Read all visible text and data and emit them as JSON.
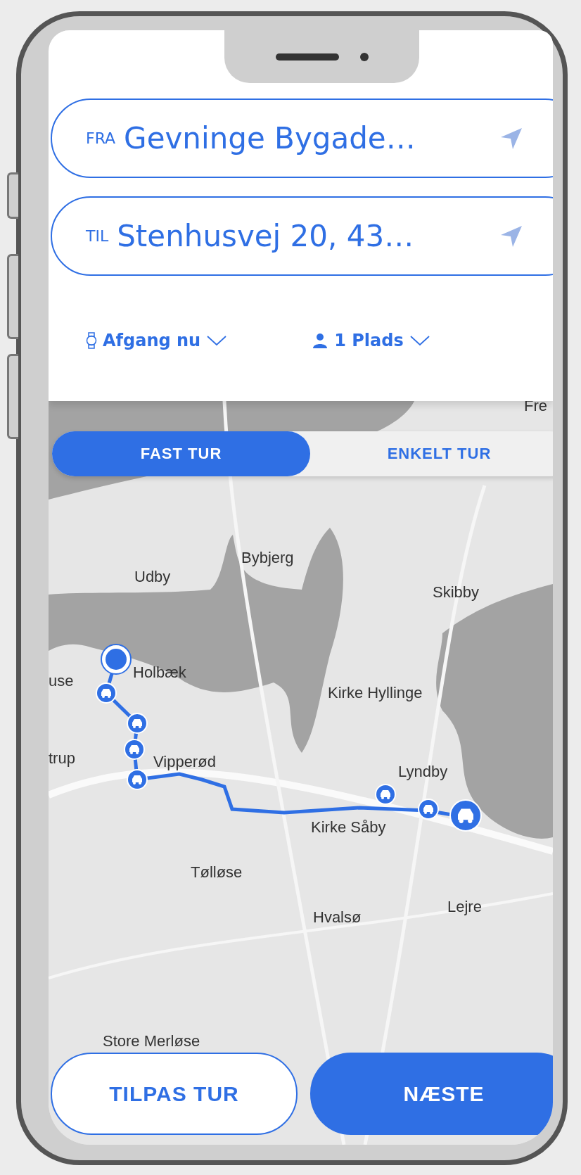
{
  "route_fields": [
    {
      "label": "FRA",
      "value": "Gevninge Bygade…"
    },
    {
      "label": "TIL",
      "value": "Stenhusvej 20, 43…"
    }
  ],
  "options": [
    {
      "kind": "time",
      "label": "Afgang nu"
    },
    {
      "kind": "seats",
      "label": "1 Plads"
    }
  ],
  "trip_type_tabs": [
    {
      "label": "FAST TUR",
      "selected": true
    },
    {
      "label": "ENKELT TUR",
      "selected": false
    }
  ],
  "map": {
    "place_labels": [
      "Fre",
      "Bybjerg",
      "Udby",
      "Skibby",
      "use",
      "Holbæk",
      "Kirke Hyllinge",
      "trup",
      "Vipperød",
      "Lyndby",
      "Kirke Såby",
      "Tølløse",
      "Lejre",
      "Hvalsø",
      "Store Merløse"
    ]
  },
  "buttons": [
    {
      "label": "TILPAS TUR",
      "kind": "secondary"
    },
    {
      "label": "NÆSTE",
      "kind": "primary"
    }
  ]
}
